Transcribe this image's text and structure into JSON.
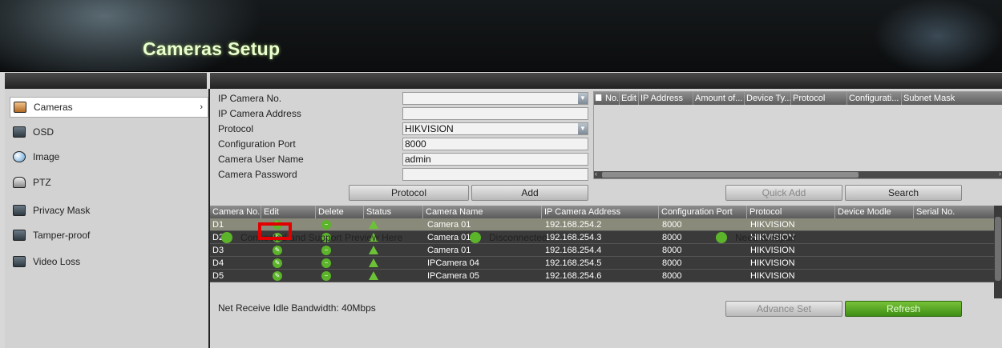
{
  "window": {
    "title": "Cameras Setup"
  },
  "sidebar": {
    "items": [
      {
        "label": "Cameras",
        "icon": "camera-icon",
        "active": true
      },
      {
        "label": "OSD",
        "icon": "osd-icon"
      },
      {
        "label": "Image",
        "icon": "image-icon"
      },
      {
        "label": "PTZ",
        "icon": "ptz-icon"
      },
      {
        "label": "Privacy Mask",
        "icon": "privacy-mask-icon"
      },
      {
        "label": "Tamper-proof",
        "icon": "tamper-proof-icon"
      },
      {
        "label": "Video Loss",
        "icon": "video-loss-icon"
      }
    ]
  },
  "form": {
    "ip_camera_no": {
      "label": "IP Camera No.",
      "value": ""
    },
    "ip_camera_address": {
      "label": "IP Camera Address",
      "value": ""
    },
    "protocol": {
      "label": "Protocol",
      "value": "HIKVISION"
    },
    "configuration_port": {
      "label": "Configuration Port",
      "value": "8000"
    },
    "camera_user_name": {
      "label": "Camera User Name",
      "value": "admin"
    },
    "camera_password": {
      "label": "Camera Password",
      "value": ""
    }
  },
  "buttons": {
    "protocol": "Protocol",
    "add": "Add",
    "quick_add": "Quick Add",
    "search": "Search",
    "advance_set": "Advance Set",
    "refresh": "Refresh"
  },
  "search_results": {
    "columns": [
      "No.",
      "Edit",
      "IP Address",
      "Amount of...",
      "Device Ty...",
      "Protocol",
      "Configurati...",
      "Subnet Mask"
    ]
  },
  "camera_table": {
    "columns": [
      "Camera No.",
      "Edit",
      "Delete",
      "Status",
      "Camera Name",
      "IP Camera Address",
      "Configuration Port",
      "Protocol",
      "Device Modle",
      "Serial No."
    ],
    "rows": [
      {
        "no": "D1",
        "name": "Camera 01",
        "address": "192.168.254.2",
        "port": "8000",
        "protocol": "HIKVISION",
        "selected": true
      },
      {
        "no": "D2",
        "name": "Camera 01",
        "address": "192.168.254.3",
        "port": "8000",
        "protocol": "HIKVISION"
      },
      {
        "no": "D3",
        "name": "Camera 01",
        "address": "192.168.254.4",
        "port": "8000",
        "protocol": "HIKVISION"
      },
      {
        "no": "D4",
        "name": "IPCamera 04",
        "address": "192.168.254.5",
        "port": "8000",
        "protocol": "HIKVISION"
      },
      {
        "no": "D5",
        "name": "IPCamera 05",
        "address": "192.168.254.6",
        "port": "8000",
        "protocol": "HIKVISION"
      }
    ]
  },
  "status": {
    "bandwidth": "Net Receive Idle Bandwidth: 40Mbps"
  },
  "legend": {
    "connected": "Connected and Support Preview Here",
    "disconnected": "Disconnected",
    "repair": "Need to repair"
  },
  "colors": {
    "accent_green": "#5cb42a",
    "highlight_red": "#e00000",
    "selected_row": "#8a8a7a"
  }
}
